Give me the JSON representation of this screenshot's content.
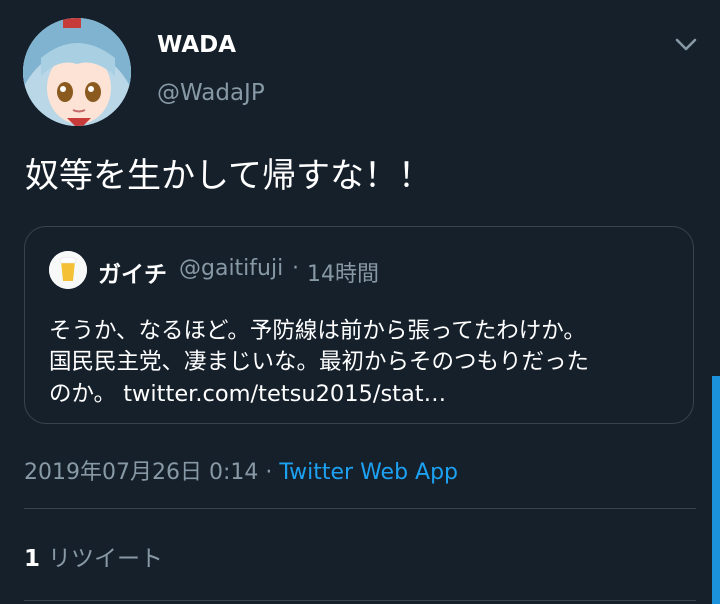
{
  "author": {
    "name": "WADA",
    "handle": "@WadaJP"
  },
  "tweet": {
    "text": "奴等を生かして帰すな！！"
  },
  "quoted": {
    "name": "ガイチ",
    "handle": "@gaitifuji",
    "separator": "·",
    "time": "14時間",
    "lines": [
      "そうか、なるほど。予防線は前から張ってたわけか。",
      "国民民主党、凄まじいな。最初からそのつもりだった",
      "のか。 twitter.com/tetsu2015/stat…"
    ]
  },
  "meta": {
    "date": "2019年07月26日 0:14",
    "separator": " · ",
    "app": "Twitter Web App"
  },
  "stats": {
    "retweet_count": "1",
    "retweet_label": "リツイート"
  },
  "icons": [
    "avatar",
    "chevron-down-icon",
    "quoted-avatar-beer-icon"
  ],
  "colors": {
    "background": "#15202b",
    "secondary_text": "#8899a6",
    "link": "#1da1f2",
    "border": "#38444d"
  }
}
